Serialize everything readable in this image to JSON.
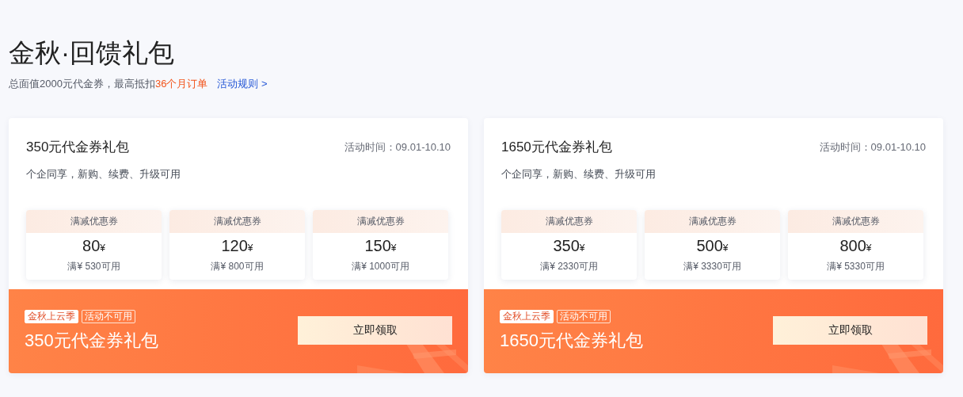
{
  "header": {
    "title": "金秋·回馈礼包",
    "subtitle": {
      "text": "总面值2000元代金券，最高抵扣",
      "highlight": "36个月订单"
    },
    "rules_link": "活动规则 >"
  },
  "packages": [
    {
      "name": "350元代金券礼包",
      "period": "活动时间：09.01-10.10",
      "description": "个企同享，新购、续费、升级可用",
      "coupons": [
        {
          "type": "满减优惠券",
          "amount": "80",
          "currency": "¥",
          "condition": "满¥ 530可用"
        },
        {
          "type": "满减优惠券",
          "amount": "120",
          "currency": "¥",
          "condition": "满¥ 800可用"
        },
        {
          "type": "满减优惠券",
          "amount": "150",
          "currency": "¥",
          "condition": "满¥ 1000可用"
        }
      ],
      "tags": [
        {
          "text": "金秋上云季",
          "kind": "solid"
        },
        {
          "text": "活动不可用",
          "kind": "outline"
        }
      ],
      "banner_title": "350元代金券礼包",
      "button": "立即领取"
    },
    {
      "name": "1650元代金券礼包",
      "period": "活动时间：09.01-10.10",
      "description": "个企同享，新购、续费、升级可用",
      "coupons": [
        {
          "type": "满减优惠券",
          "amount": "350",
          "currency": "¥",
          "condition": "满¥ 2330可用"
        },
        {
          "type": "满减优惠券",
          "amount": "500",
          "currency": "¥",
          "condition": "满¥ 3330可用"
        },
        {
          "type": "满减优惠券",
          "amount": "800",
          "currency": "¥",
          "condition": "满¥ 5330可用"
        }
      ],
      "tags": [
        {
          "text": "金秋上云季",
          "kind": "solid"
        },
        {
          "text": "活动不可用",
          "kind": "outline"
        }
      ],
      "banner_title": "1650元代金券礼包",
      "button": "立即领取"
    }
  ]
}
